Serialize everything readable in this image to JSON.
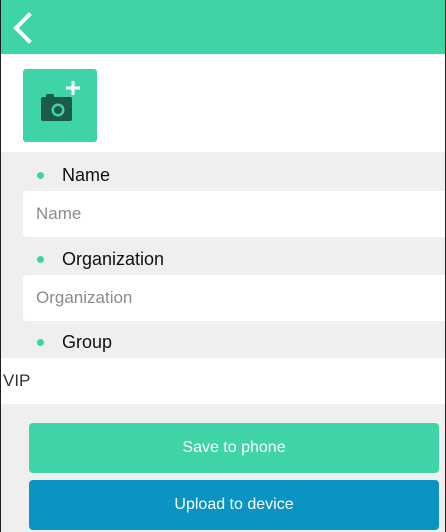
{
  "colors": {
    "accent": "#3fd3a8",
    "upload_button": "#0b93c4",
    "background": "#efefef"
  },
  "header": {
    "back_icon": "chevron-left-icon"
  },
  "avatar": {
    "icon": "camera-plus-icon"
  },
  "form": {
    "name": {
      "label": "Name",
      "placeholder": "Name",
      "value": ""
    },
    "organization": {
      "label": "Organization",
      "placeholder": "Organization",
      "value": ""
    },
    "group": {
      "label": "Group",
      "value": "VIP"
    }
  },
  "actions": {
    "save_label": "Save to phone",
    "upload_label": "Upload to device"
  }
}
